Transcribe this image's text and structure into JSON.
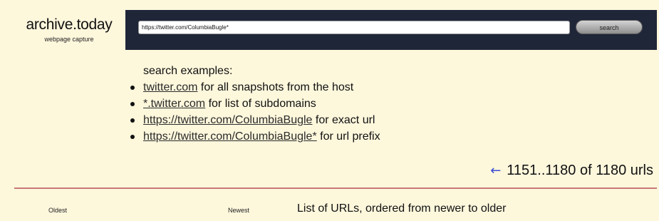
{
  "logo": {
    "title": "archive.today",
    "subtitle": "webpage capture"
  },
  "search": {
    "value": "https://twitter.com/ColumbiaBugle*",
    "button_label": "search"
  },
  "examples": {
    "title": "search examples:",
    "items": [
      {
        "link": "twitter.com",
        "text": " for all snapshots from the host"
      },
      {
        "link": "*.twitter.com",
        "text": " for list of subdomains"
      },
      {
        "link": "https://twitter.com/ColumbiaBugle",
        "text": " for exact url"
      },
      {
        "link": "https://twitter.com/ColumbiaBugle*",
        "text": " for url prefix"
      }
    ]
  },
  "pager": {
    "arrow": "←",
    "range": "1151..1180 of 1180 urls"
  },
  "table": {
    "oldest_label": "Oldest",
    "newest_label": "Newest",
    "title": "List of URLs, ordered from newer to older"
  },
  "colors": {
    "header_bg": "#1f2638",
    "page_bg": "#fdf7dc",
    "divider": "#c87878",
    "arrow": "#3b4bd6"
  }
}
